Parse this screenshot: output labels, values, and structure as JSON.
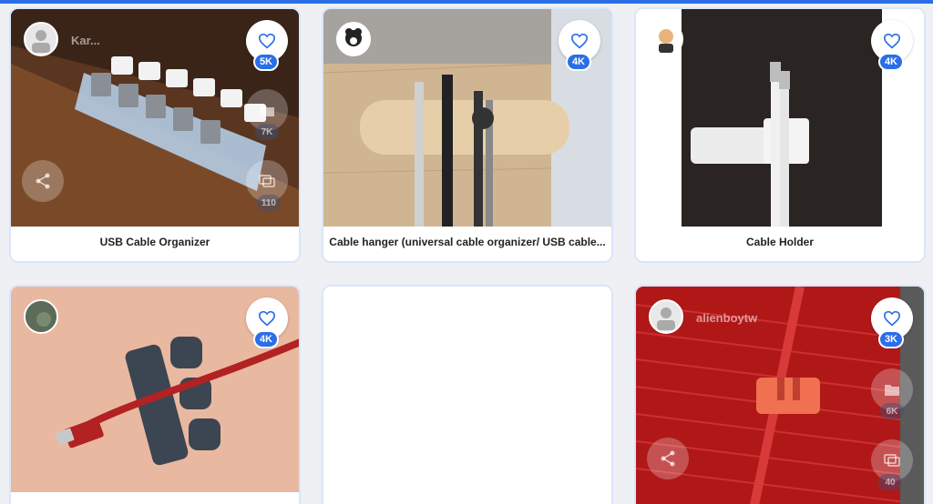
{
  "cards": [
    {
      "title": "USB Cable Organizer",
      "username": "Kar...",
      "likes": "5K",
      "collections": "7K",
      "comments": "110"
    },
    {
      "title": "Cable hanger (universal cable organizer/ USB cable...",
      "likes": "4K"
    },
    {
      "title": "Cable Holder",
      "likes": "4K"
    },
    {
      "title": "",
      "likes": "4K"
    },
    {
      "title": ""
    },
    {
      "title": "",
      "username": "alienboytw",
      "likes": "3K",
      "collections": "6K",
      "comments": "40"
    }
  ],
  "colors": {
    "accent": "#2a6ee8",
    "card_border": "#d8e6fb",
    "background": "#eef0f3"
  },
  "icons": [
    "heart-icon",
    "folder-icon",
    "comments-icon",
    "share-icon"
  ]
}
